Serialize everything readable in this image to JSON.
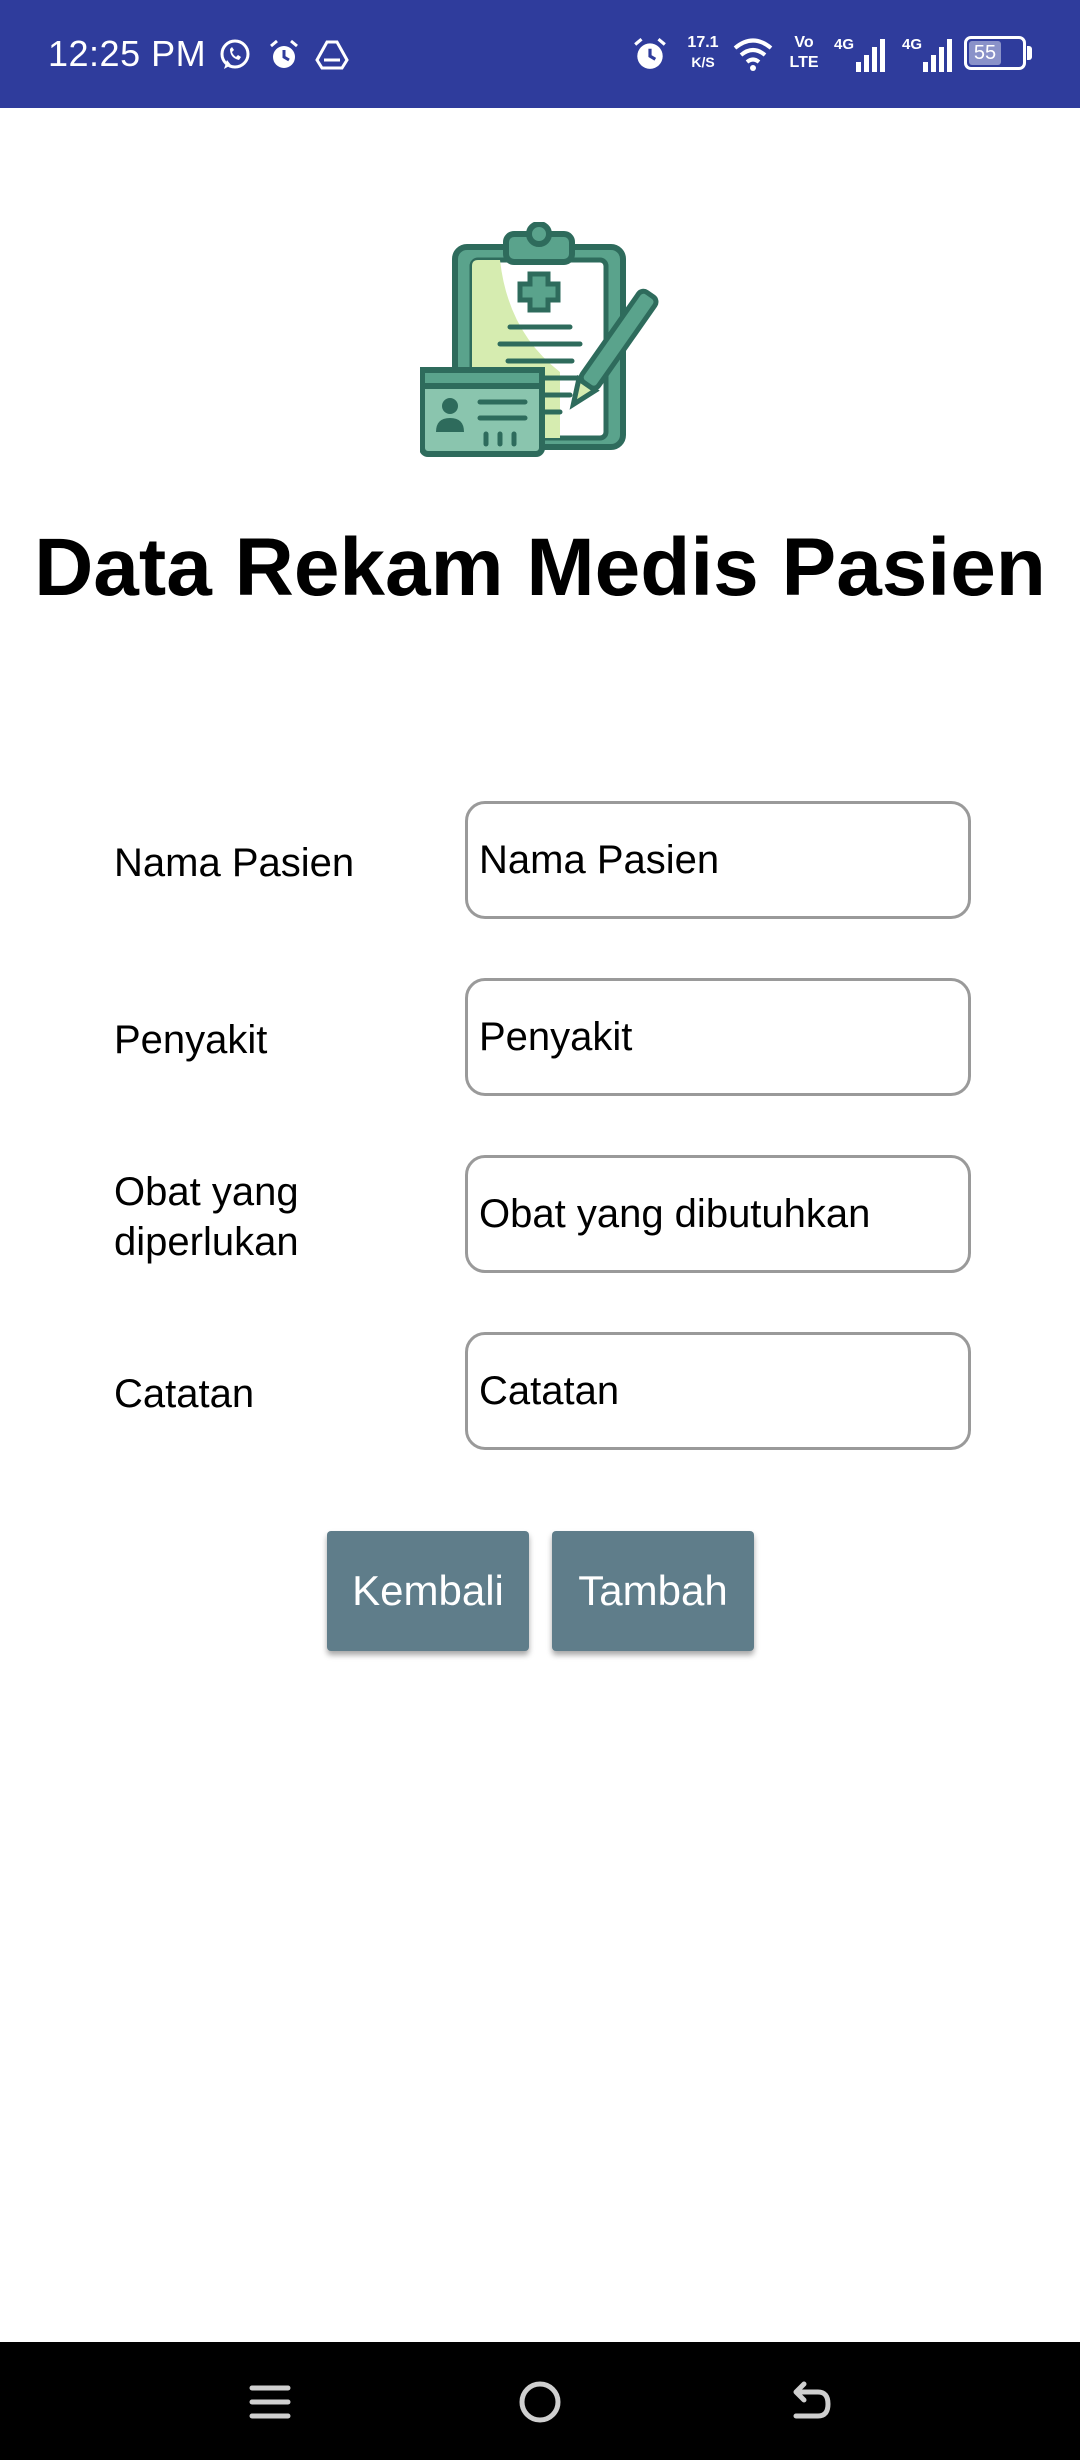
{
  "status_bar": {
    "time": "12:25 PM",
    "network_speed_value": "17.1",
    "network_speed_unit": "K/S",
    "volte_top": "Vo",
    "volte_bottom": "LTE",
    "signal1_label": "4G",
    "signal2_label": "4G",
    "battery": "55",
    "background_color": "#2f3c9c"
  },
  "header": {
    "logo_icon": "medical-clipboard-icon",
    "title": "Data Rekam Medis Pasien"
  },
  "form": {
    "fields": [
      {
        "label": "Nama Pasien",
        "placeholder": "Nama Pasien",
        "value": ""
      },
      {
        "label": "Penyakit",
        "placeholder": "Penyakit",
        "value": ""
      },
      {
        "label": "Obat yang diperlukan",
        "placeholder": "Obat yang dibutuhkan",
        "value": ""
      },
      {
        "label": "Catatan",
        "placeholder": "Catatan",
        "value": ""
      }
    ]
  },
  "buttons": {
    "back_label": "Kembali",
    "add_label": "Tambah",
    "color": "#5f7d8a"
  },
  "nav_bar": {
    "icons": [
      "menu-icon",
      "home-icon",
      "back-icon"
    ]
  }
}
